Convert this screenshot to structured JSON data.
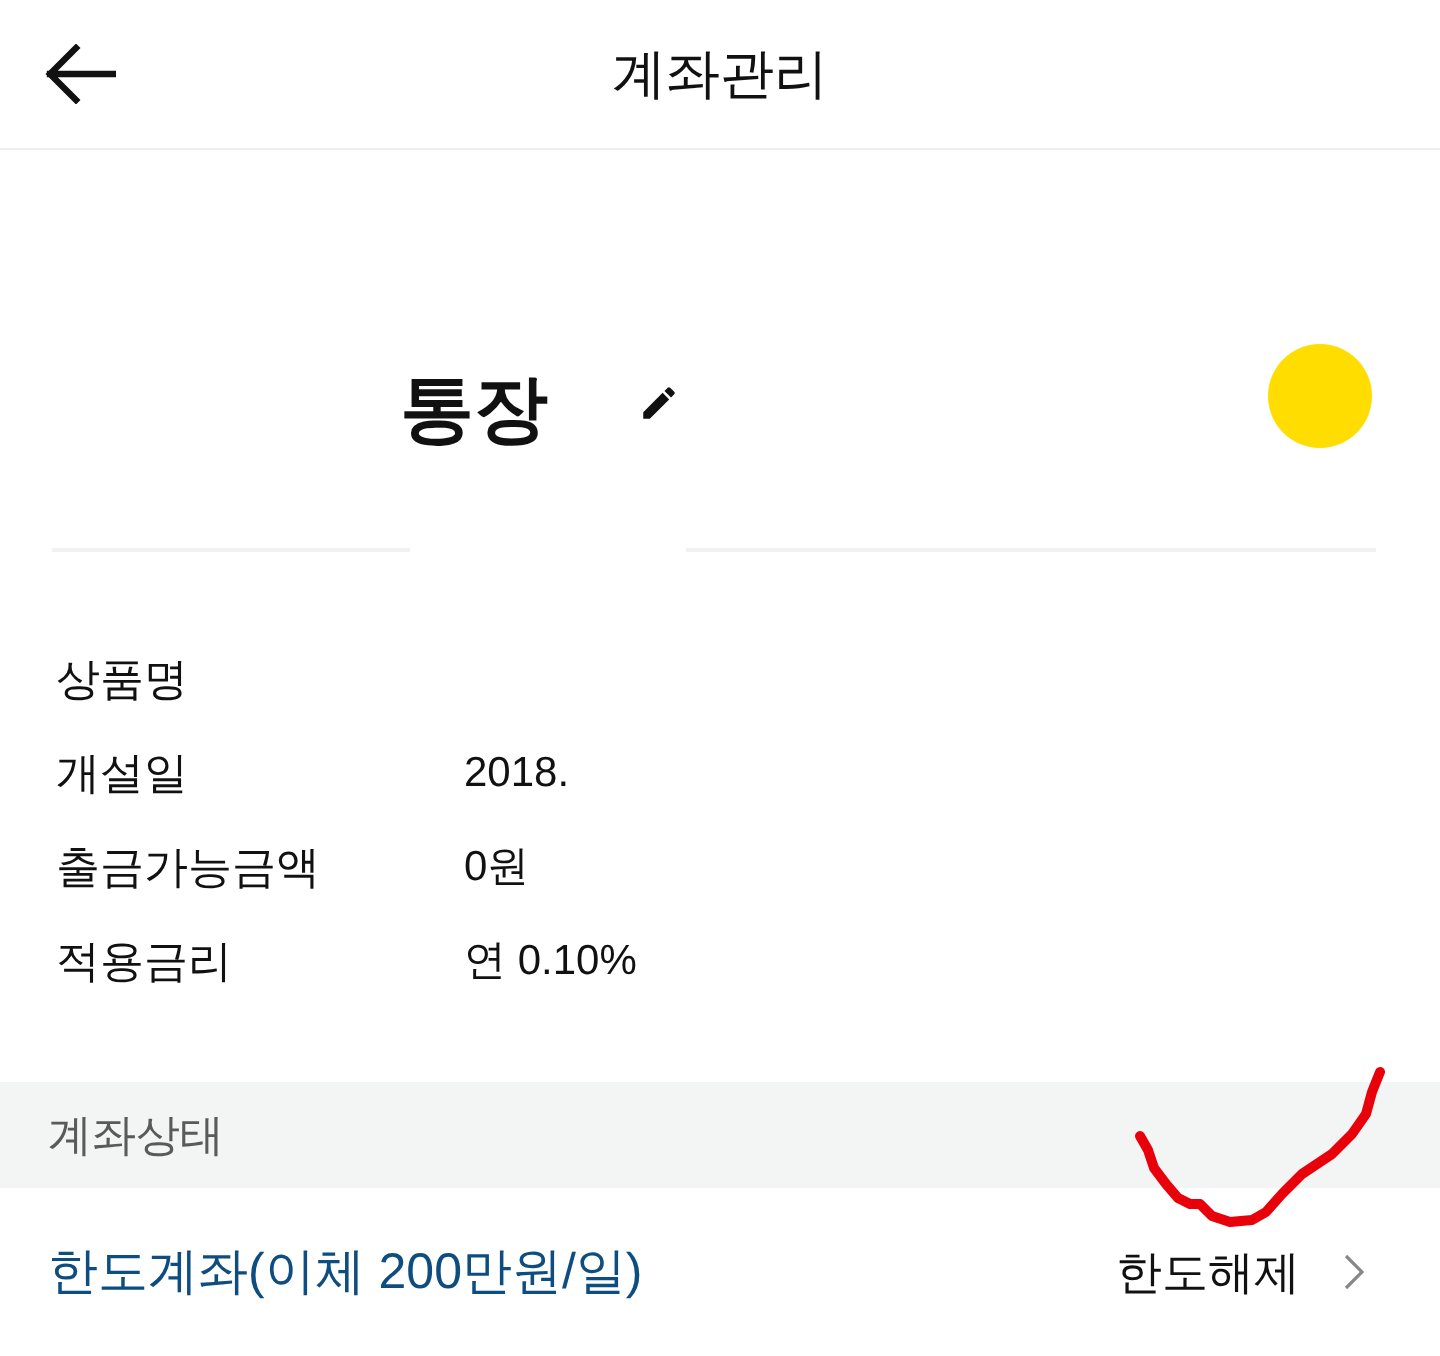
{
  "header": {
    "title": "계좌관리"
  },
  "account": {
    "name": "통장"
  },
  "details": [
    {
      "label": "상품명"
    },
    {
      "label": "개설일",
      "value": "2018."
    },
    {
      "label": "출금가능금액",
      "value": "0원"
    },
    {
      "label": "적용금리",
      "value": "연 0.10%"
    }
  ],
  "status_section": {
    "title": "계좌상태",
    "status": "한도계좌(이체 200만원/일)",
    "action": "한도해제"
  }
}
